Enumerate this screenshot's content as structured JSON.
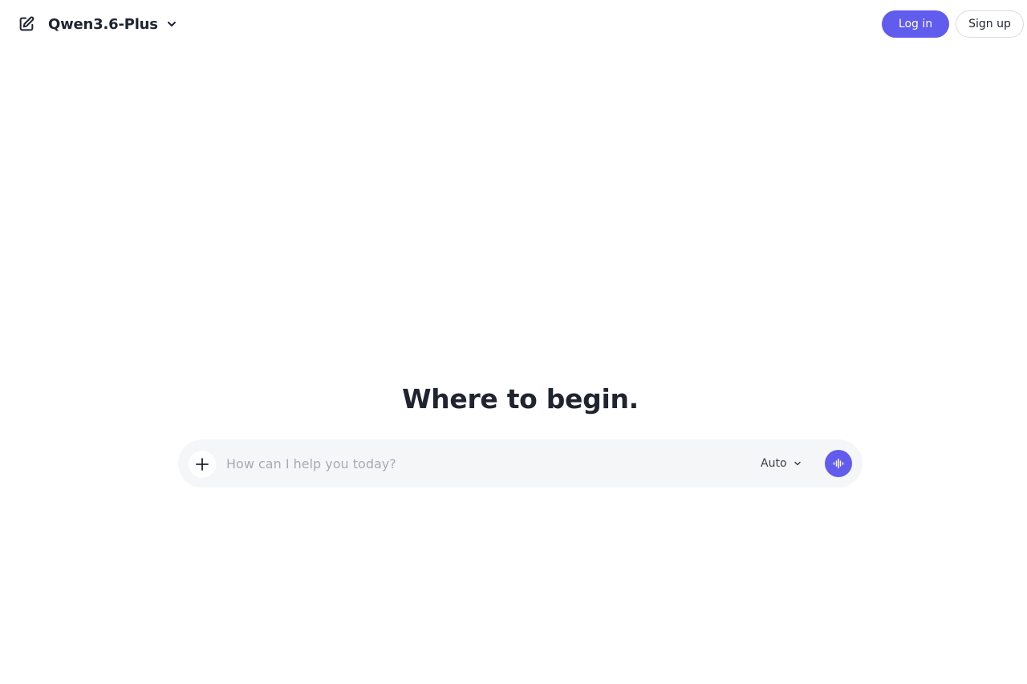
{
  "header": {
    "new_chat_icon": "edit-icon",
    "model_name": "Qwen3.6-Plus",
    "model_chevron_icon": "chevron-down-icon",
    "login_label": "Log in",
    "signup_label": "Sign up"
  },
  "main": {
    "headline": "Where to begin."
  },
  "composer": {
    "attach_icon": "plus-icon",
    "input_value": "",
    "input_placeholder": "How can I help you today?",
    "mode_label": "Auto",
    "mode_chevron_icon": "chevron-down-icon",
    "voice_icon": "voice-wave-icon"
  },
  "colors": {
    "accent": "#615ced",
    "text": "#1f2430",
    "composer_bg": "#f5f6f8",
    "placeholder": "#a6abb6"
  }
}
